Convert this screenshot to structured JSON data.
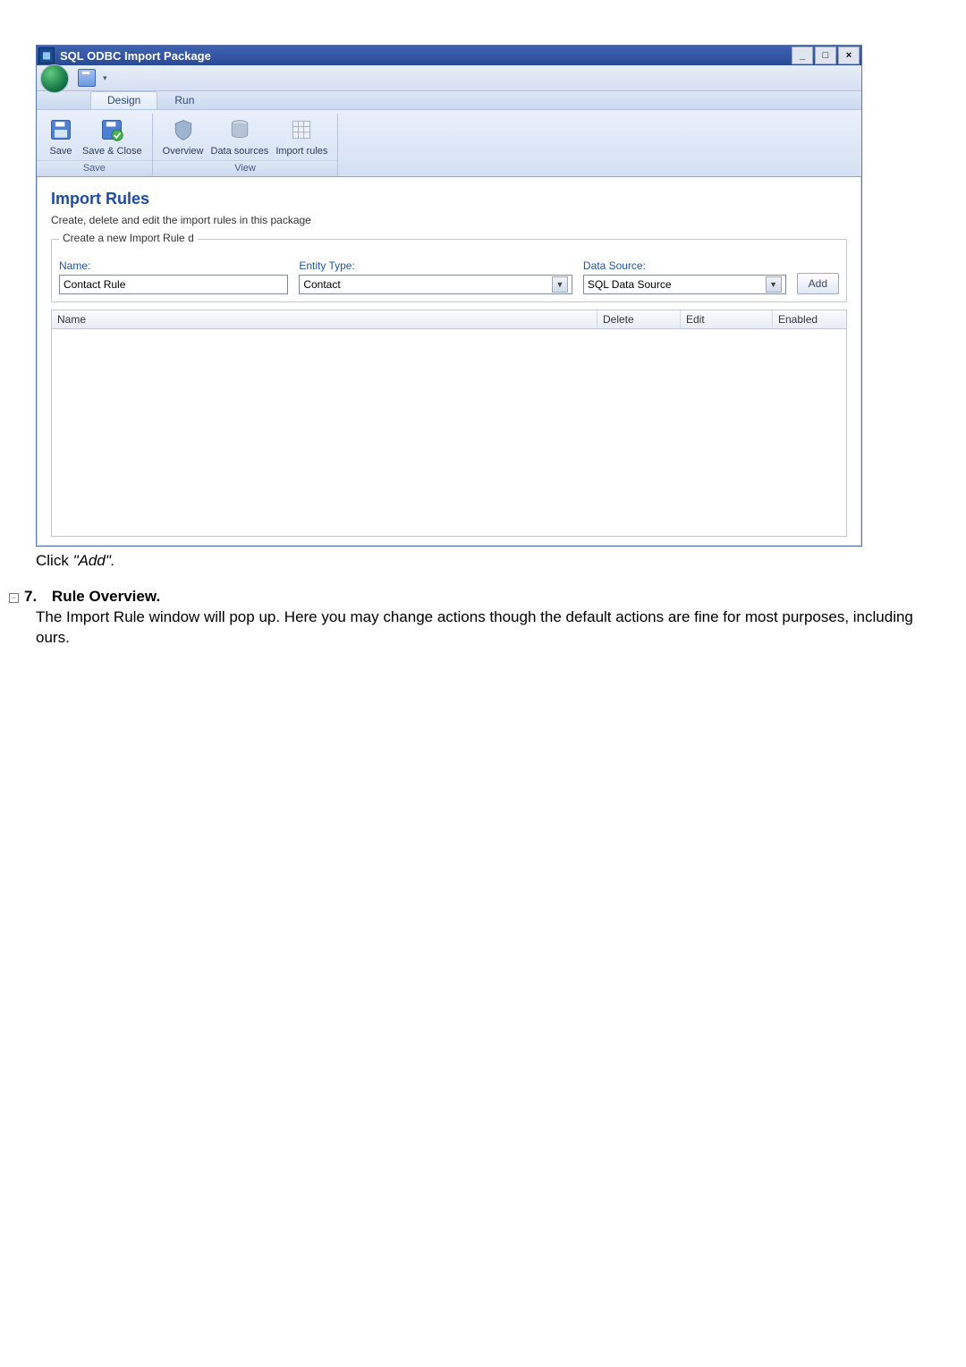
{
  "window": {
    "title": "SQL ODBC Import Package",
    "tabs": {
      "design": "Design",
      "run": "Run"
    },
    "ribbon": {
      "save_group_name": "Save",
      "view_group_name": "View",
      "btn_save": "Save",
      "btn_save_close": "Save & Close",
      "btn_overview": "Overview",
      "btn_data_sources": "Data sources",
      "btn_import_rules": "Import rules"
    },
    "content": {
      "heading": "Import Rules",
      "sub": "Create, delete and edit the import rules in this package",
      "group_legend": "Create a new Import Rule d",
      "lbl_name": "Name:",
      "lbl_entity": "Entity Type:",
      "lbl_ds": "Data Source:",
      "val_name": "Contact Rule",
      "val_entity": "Contact",
      "val_ds": "SQL Data Source",
      "btn_add": "Add",
      "grid_cols": {
        "name": "Name",
        "delete": "Delete",
        "edit": "Edit",
        "enabled": "Enabled"
      }
    }
  },
  "doc": {
    "caption_prefix": "Click ",
    "caption_quoted": "\"Add\".",
    "step_num": "7.",
    "step_title": "Rule Overview.",
    "step_body": "The Import Rule window will pop up.  Here you may change actions though the default actions are fine for most purposes, including ours."
  }
}
